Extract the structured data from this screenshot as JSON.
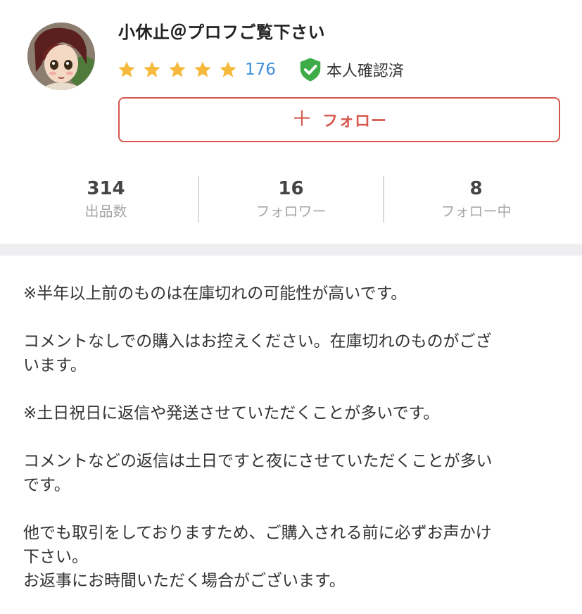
{
  "profile": {
    "username": "小休止＠プロフご覧下さい",
    "rating": 5,
    "review_count": "176",
    "verified_label": "本人確認済"
  },
  "follow_button": {
    "label": "フォロー",
    "icon": "plus-icon"
  },
  "stats": [
    {
      "value": "314",
      "label": "出品数"
    },
    {
      "value": "16",
      "label": "フォロワー"
    },
    {
      "value": "8",
      "label": "フォロー中"
    }
  ],
  "bio": {
    "paragraphs": [
      [
        "※半年以上前のものは在庫切れの可能性が高いです。"
      ],
      [
        "コメントなしでの購入はお控えください。在庫切れのものがござ",
        "います。"
      ],
      [
        "※土日祝日に返信や発送させていただくことが多いです。"
      ],
      [
        "コメントなどの返信は土日ですと夜にさせていただくことが多い",
        "です。"
      ],
      [
        "他でも取引をしておりますため、ご購入される前に必ずお声かけ",
        "下さい。",
        "お返事にお時間いただく場合がございます。"
      ]
    ]
  },
  "colors": {
    "accent": "#d6584c",
    "star": "#f6b93b",
    "link": "#3c8fd8",
    "verified": "#3cab48"
  }
}
